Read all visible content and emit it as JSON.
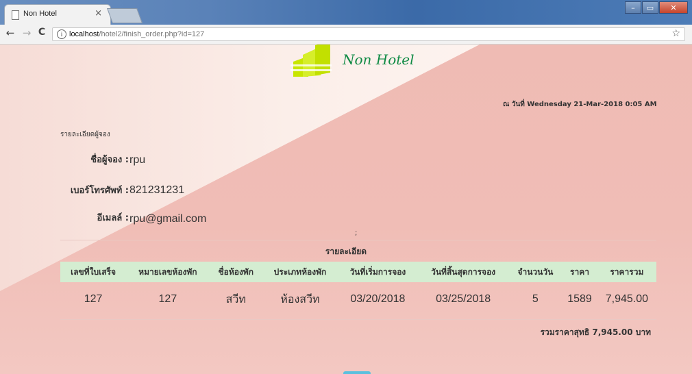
{
  "browser": {
    "tab_title": "Non Hotel",
    "tab_close": "×",
    "url_host": "localhost",
    "url_path": "/hotel2/finish_order.php?id=127",
    "back_icon": "←",
    "forward_icon": "→",
    "reload_icon": "C",
    "info_icon": "i",
    "star_icon": "☆",
    "window_minimize": "–",
    "window_restore": "▭",
    "window_close": "✕"
  },
  "header": {
    "logo_text": "Non Hotel",
    "date_stamp": "ณ วันที่ Wednesday 21-Mar-2018 0:05 AM"
  },
  "customer": {
    "section_label": "รายละเอียดผู้จอง",
    "name_label": "ชื่อผู้จอง :",
    "name_value": "rpu",
    "phone_label": "เบอร์โทรศัพท์ :",
    "phone_value": "821231231",
    "email_label": "อีเมลล์ :",
    "email_value": "rpu@gmail.com"
  },
  "semicolon": ";",
  "details": {
    "heading": "รายละเอียด",
    "columns": [
      "เลขที่ใบเสร็จ",
      "หมายเลขห้องพัก",
      "ชื่อห้องพัก",
      "ประเภทห้องพัก",
      "วันที่เริ่มการจอง",
      "วันที่สิ้นสุดการจอง",
      "จำนวนวัน",
      "ราคา",
      "ราคารวม"
    ],
    "rows": [
      [
        "127",
        "127",
        "สวีท",
        "ห้องสวีท",
        "03/20/2018",
        "03/25/2018",
        "5",
        "1589",
        "7,945.00"
      ]
    ],
    "total_text": "รวมราคาสุทธิ 7,945.00 บาท"
  },
  "colors": {
    "page_bg": "#efbbb4",
    "header_row": "#d4edd1",
    "logo_green": "#0f8a44",
    "logo_lime": "#c8e600"
  }
}
